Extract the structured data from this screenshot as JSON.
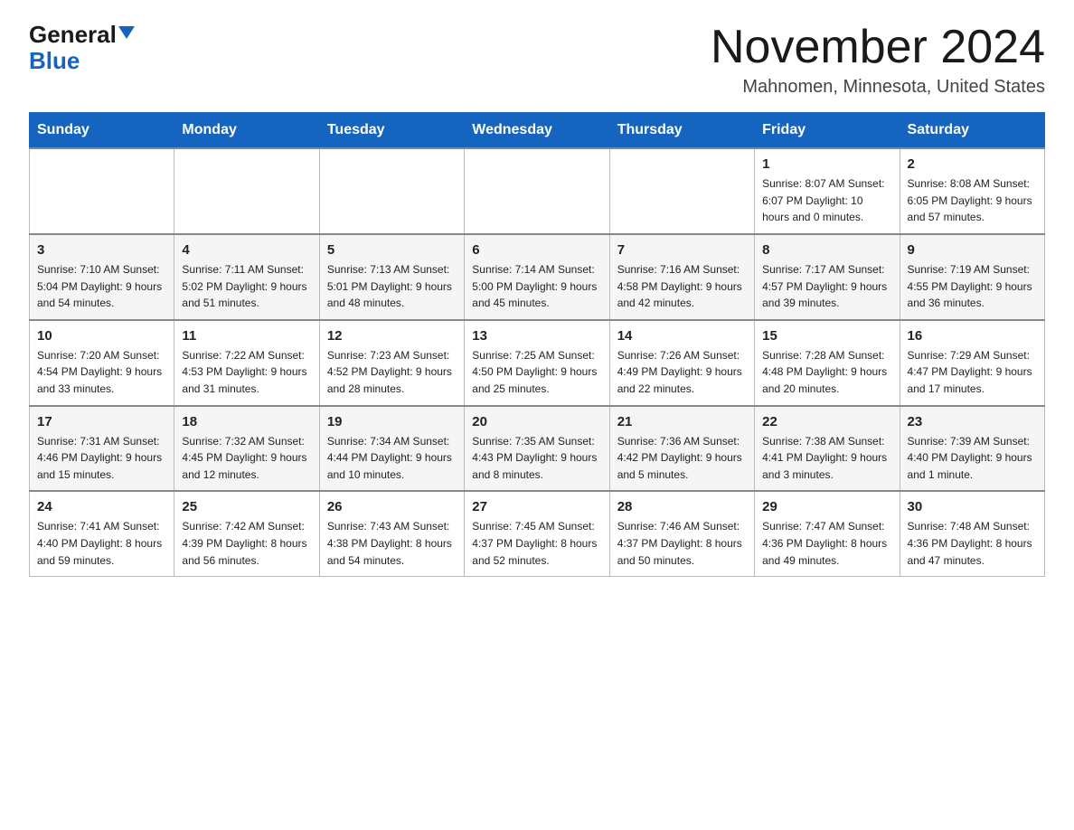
{
  "logo": {
    "general": "General",
    "blue": "Blue"
  },
  "title": {
    "month": "November 2024",
    "location": "Mahnomen, Minnesota, United States"
  },
  "weekdays": [
    "Sunday",
    "Monday",
    "Tuesday",
    "Wednesday",
    "Thursday",
    "Friday",
    "Saturday"
  ],
  "weeks": [
    [
      {
        "day": "",
        "info": ""
      },
      {
        "day": "",
        "info": ""
      },
      {
        "day": "",
        "info": ""
      },
      {
        "day": "",
        "info": ""
      },
      {
        "day": "",
        "info": ""
      },
      {
        "day": "1",
        "info": "Sunrise: 8:07 AM\nSunset: 6:07 PM\nDaylight: 10 hours and 0 minutes."
      },
      {
        "day": "2",
        "info": "Sunrise: 8:08 AM\nSunset: 6:05 PM\nDaylight: 9 hours and 57 minutes."
      }
    ],
    [
      {
        "day": "3",
        "info": "Sunrise: 7:10 AM\nSunset: 5:04 PM\nDaylight: 9 hours and 54 minutes."
      },
      {
        "day": "4",
        "info": "Sunrise: 7:11 AM\nSunset: 5:02 PM\nDaylight: 9 hours and 51 minutes."
      },
      {
        "day": "5",
        "info": "Sunrise: 7:13 AM\nSunset: 5:01 PM\nDaylight: 9 hours and 48 minutes."
      },
      {
        "day": "6",
        "info": "Sunrise: 7:14 AM\nSunset: 5:00 PM\nDaylight: 9 hours and 45 minutes."
      },
      {
        "day": "7",
        "info": "Sunrise: 7:16 AM\nSunset: 4:58 PM\nDaylight: 9 hours and 42 minutes."
      },
      {
        "day": "8",
        "info": "Sunrise: 7:17 AM\nSunset: 4:57 PM\nDaylight: 9 hours and 39 minutes."
      },
      {
        "day": "9",
        "info": "Sunrise: 7:19 AM\nSunset: 4:55 PM\nDaylight: 9 hours and 36 minutes."
      }
    ],
    [
      {
        "day": "10",
        "info": "Sunrise: 7:20 AM\nSunset: 4:54 PM\nDaylight: 9 hours and 33 minutes."
      },
      {
        "day": "11",
        "info": "Sunrise: 7:22 AM\nSunset: 4:53 PM\nDaylight: 9 hours and 31 minutes."
      },
      {
        "day": "12",
        "info": "Sunrise: 7:23 AM\nSunset: 4:52 PM\nDaylight: 9 hours and 28 minutes."
      },
      {
        "day": "13",
        "info": "Sunrise: 7:25 AM\nSunset: 4:50 PM\nDaylight: 9 hours and 25 minutes."
      },
      {
        "day": "14",
        "info": "Sunrise: 7:26 AM\nSunset: 4:49 PM\nDaylight: 9 hours and 22 minutes."
      },
      {
        "day": "15",
        "info": "Sunrise: 7:28 AM\nSunset: 4:48 PM\nDaylight: 9 hours and 20 minutes."
      },
      {
        "day": "16",
        "info": "Sunrise: 7:29 AM\nSunset: 4:47 PM\nDaylight: 9 hours and 17 minutes."
      }
    ],
    [
      {
        "day": "17",
        "info": "Sunrise: 7:31 AM\nSunset: 4:46 PM\nDaylight: 9 hours and 15 minutes."
      },
      {
        "day": "18",
        "info": "Sunrise: 7:32 AM\nSunset: 4:45 PM\nDaylight: 9 hours and 12 minutes."
      },
      {
        "day": "19",
        "info": "Sunrise: 7:34 AM\nSunset: 4:44 PM\nDaylight: 9 hours and 10 minutes."
      },
      {
        "day": "20",
        "info": "Sunrise: 7:35 AM\nSunset: 4:43 PM\nDaylight: 9 hours and 8 minutes."
      },
      {
        "day": "21",
        "info": "Sunrise: 7:36 AM\nSunset: 4:42 PM\nDaylight: 9 hours and 5 minutes."
      },
      {
        "day": "22",
        "info": "Sunrise: 7:38 AM\nSunset: 4:41 PM\nDaylight: 9 hours and 3 minutes."
      },
      {
        "day": "23",
        "info": "Sunrise: 7:39 AM\nSunset: 4:40 PM\nDaylight: 9 hours and 1 minute."
      }
    ],
    [
      {
        "day": "24",
        "info": "Sunrise: 7:41 AM\nSunset: 4:40 PM\nDaylight: 8 hours and 59 minutes."
      },
      {
        "day": "25",
        "info": "Sunrise: 7:42 AM\nSunset: 4:39 PM\nDaylight: 8 hours and 56 minutes."
      },
      {
        "day": "26",
        "info": "Sunrise: 7:43 AM\nSunset: 4:38 PM\nDaylight: 8 hours and 54 minutes."
      },
      {
        "day": "27",
        "info": "Sunrise: 7:45 AM\nSunset: 4:37 PM\nDaylight: 8 hours and 52 minutes."
      },
      {
        "day": "28",
        "info": "Sunrise: 7:46 AM\nSunset: 4:37 PM\nDaylight: 8 hours and 50 minutes."
      },
      {
        "day": "29",
        "info": "Sunrise: 7:47 AM\nSunset: 4:36 PM\nDaylight: 8 hours and 49 minutes."
      },
      {
        "day": "30",
        "info": "Sunrise: 7:48 AM\nSunset: 4:36 PM\nDaylight: 8 hours and 47 minutes."
      }
    ]
  ]
}
